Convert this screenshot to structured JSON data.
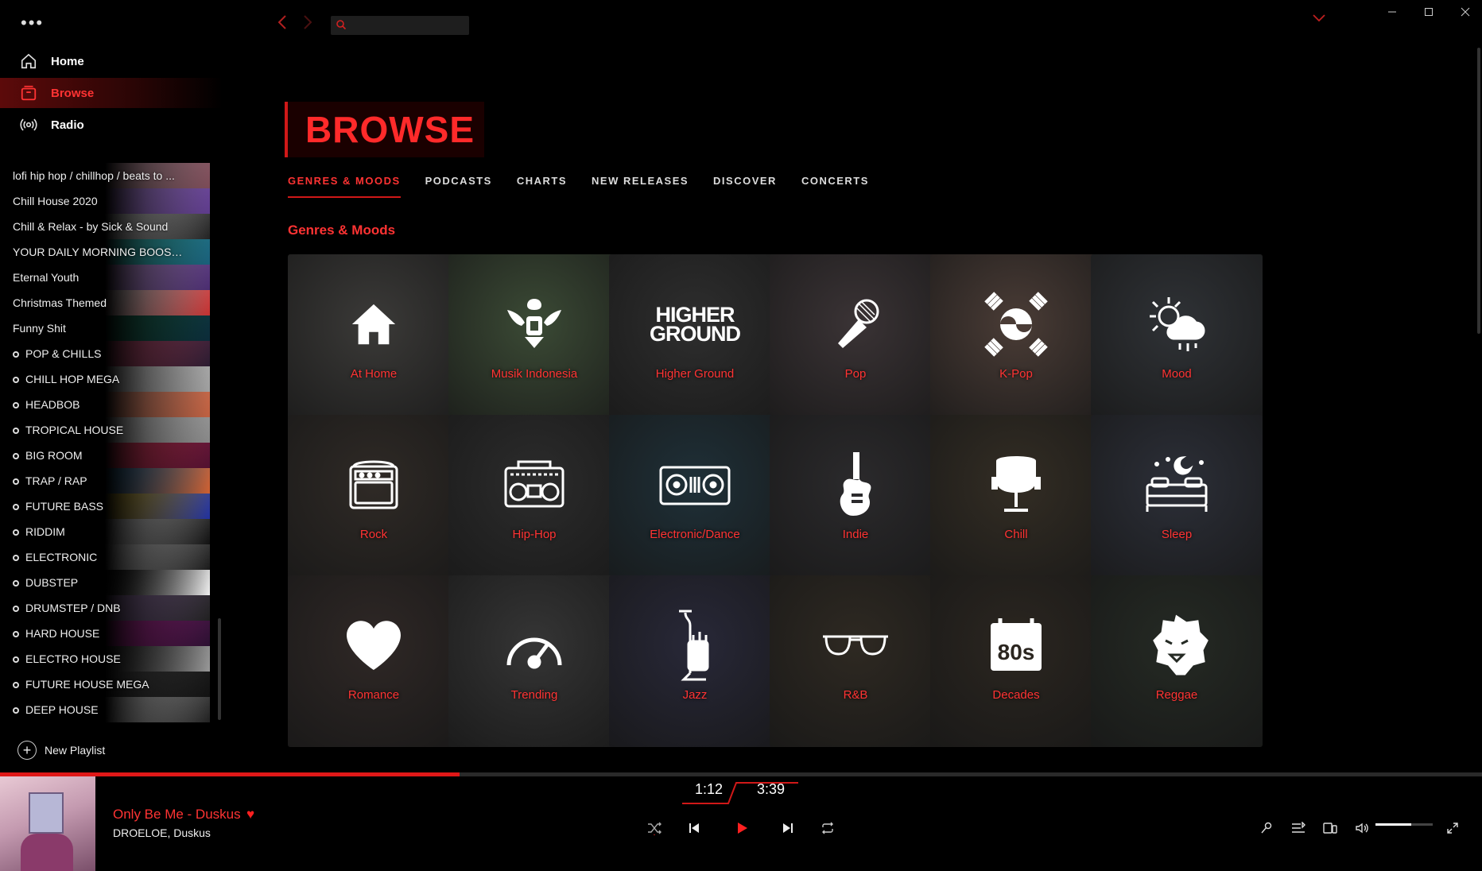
{
  "sidebar": {
    "menu_glyph": "•••",
    "nav": [
      {
        "label": "Home",
        "icon": "home-icon"
      },
      {
        "label": "Browse",
        "icon": "browse-icon",
        "active": true
      },
      {
        "label": "Radio",
        "icon": "radio-icon"
      }
    ],
    "playlists": [
      {
        "label": "lofi hip hop / chillhop / beats to ...",
        "bullet": false
      },
      {
        "label": "Chill House 2020",
        "bullet": false
      },
      {
        "label": "Chill & Relax - by Sick & Sound",
        "bullet": false
      },
      {
        "label": "YOUR DAILY MORNING BOOST...",
        "bullet": false
      },
      {
        "label": "Eternal Youth",
        "bullet": false
      },
      {
        "label": "Christmas Themed",
        "bullet": false
      },
      {
        "label": "Funny Shit",
        "bullet": false
      },
      {
        "label": "POP & CHILLS",
        "bullet": true
      },
      {
        "label": "CHILL HOP MEGA",
        "bullet": true
      },
      {
        "label": "HEADBOB",
        "bullet": true
      },
      {
        "label": "TROPICAL HOUSE",
        "bullet": true
      },
      {
        "label": "BIG ROOM",
        "bullet": true
      },
      {
        "label": "TRAP / RAP",
        "bullet": true
      },
      {
        "label": "FUTURE BASS",
        "bullet": true
      },
      {
        "label": "RIDDIM",
        "bullet": true
      },
      {
        "label": "ELECTRONIC",
        "bullet": true
      },
      {
        "label": "DUBSTEP",
        "bullet": true
      },
      {
        "label": "DRUMSTEP / DNB",
        "bullet": true
      },
      {
        "label": "HARD HOUSE",
        "bullet": true
      },
      {
        "label": "ELECTRO HOUSE",
        "bullet": true
      },
      {
        "label": "FUTURE HOUSE MEGA",
        "bullet": true
      },
      {
        "label": "DEEP HOUSE",
        "bullet": true
      }
    ],
    "new_playlist_label": "New Playlist"
  },
  "topbar": {
    "search_value": "",
    "back_icon": "chevron-left-icon",
    "forward_icon": "chevron-right-icon",
    "account_icon": "chevron-down-icon",
    "window_controls": [
      "minimize",
      "maximize",
      "close"
    ]
  },
  "main": {
    "page_title": "BROWSE",
    "tabs": [
      {
        "label": "GENRES & MOODS",
        "active": true
      },
      {
        "label": "PODCASTS"
      },
      {
        "label": "CHARTS"
      },
      {
        "label": "NEW RELEASES"
      },
      {
        "label": "DISCOVER"
      },
      {
        "label": "CONCERTS"
      }
    ],
    "section_title": "Genres & Moods",
    "tiles": [
      {
        "label": "At Home",
        "icon": "house-icon",
        "bg": "#3b3a38"
      },
      {
        "label": "Musik Indonesia",
        "icon": "garuda-icon",
        "bg": "#3b4a35"
      },
      {
        "label": "Higher Ground",
        "icon": "higher-ground-logo",
        "logo_text": "HIGHER GROUND",
        "bg": "#2e2e2e"
      },
      {
        "label": "Pop",
        "icon": "microphone-icon",
        "bg": "#3a3335"
      },
      {
        "label": "K-Pop",
        "icon": "taegeuk-icon",
        "bg": "#4a3c36"
      },
      {
        "label": "Mood",
        "icon": "sun-cloud-icon",
        "bg": "#2f3236"
      },
      {
        "label": "Rock",
        "icon": "amplifier-icon",
        "bg": "#2f2a26"
      },
      {
        "label": "Hip-Hop",
        "icon": "boombox-icon",
        "bg": "#2c2c2c"
      },
      {
        "label": "Electronic/Dance",
        "icon": "turntables-icon",
        "bg": "#1f3038"
      },
      {
        "label": "Indie",
        "icon": "guitar-icon",
        "bg": "#2b2a2c"
      },
      {
        "label": "Chill",
        "icon": "egg-chair-icon",
        "bg": "#332d24"
      },
      {
        "label": "Sleep",
        "icon": "bed-moon-icon",
        "bg": "#2c2f38"
      },
      {
        "label": "Romance",
        "icon": "heart-icon",
        "bg": "#2f2826"
      },
      {
        "label": "Trending",
        "icon": "gauge-icon",
        "bg": "#353535"
      },
      {
        "label": "Jazz",
        "icon": "trumpet-icon",
        "bg": "#282838"
      },
      {
        "label": "R&B",
        "icon": "sunglasses-icon",
        "bg": "#2e2922"
      },
      {
        "label": "Decades",
        "icon": "calendar-80s-icon",
        "logo_text": "80s",
        "bg": "#2b2620"
      },
      {
        "label": "Reggae",
        "icon": "lion-icon",
        "bg": "#252a24"
      }
    ]
  },
  "player": {
    "song_title": "Only Be Me - Duskus",
    "artist": "DROELOE, Duskus",
    "elapsed": "1:12",
    "duration": "3:39",
    "progress_fraction": 0.31,
    "volume_fraction": 0.62,
    "liked": true,
    "cover_icon": "album-cover"
  },
  "colors": {
    "accent": "#ff3333",
    "accent_dark": "#d01818",
    "background": "#000000"
  }
}
